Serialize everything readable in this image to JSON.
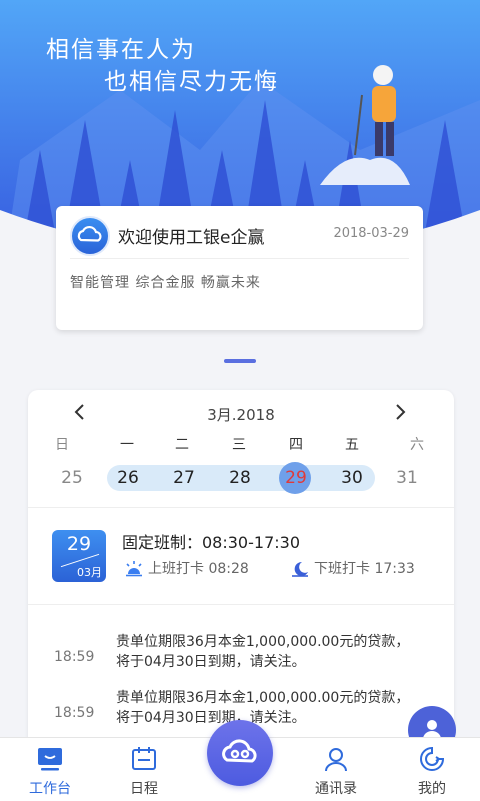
{
  "hero": {
    "slogan_line1": "相信事在人为",
    "slogan_line2": "也相信尽力无悔"
  },
  "welcome": {
    "logo_icon": "cloud-logo-icon",
    "title": "欢迎使用工银e企赢",
    "date": "2018-03-29",
    "subtitle": "智能管理 综合金服 畅赢未来"
  },
  "calendar": {
    "month_label": "3月.2018",
    "prev_icon": "chevron-left-icon",
    "next_icon": "chevron-right-icon",
    "weekdays": [
      "日",
      "一",
      "二",
      "三",
      "四",
      "五",
      "六"
    ],
    "days": [
      "25",
      "26",
      "27",
      "28",
      "29",
      "30",
      "31"
    ],
    "today_index": 4
  },
  "attendance": {
    "badge_day": "29",
    "badge_month": "03月",
    "shift": "固定班制：08:30-17:30",
    "checkin": "上班打卡 08:28",
    "checkout": "下班打卡 17:33"
  },
  "messages": [
    {
      "time": "18:59",
      "text": "贵单位期限36月本金1,000,000.00元的贷款，将于04月30日到期，请关注。"
    },
    {
      "time": "18:59",
      "text": "贵单位期限36月本金1,000,000.00元的贷款，将于04月30日到期，请关注。"
    }
  ],
  "tabbar": {
    "workbench": "工作台",
    "schedule": "日程",
    "contacts": "通讯录",
    "mine": "我的"
  },
  "colors": {
    "accent": "#2f6bdc",
    "hero_top": "#4f9ff6",
    "hero_bottom": "#3046d8"
  }
}
